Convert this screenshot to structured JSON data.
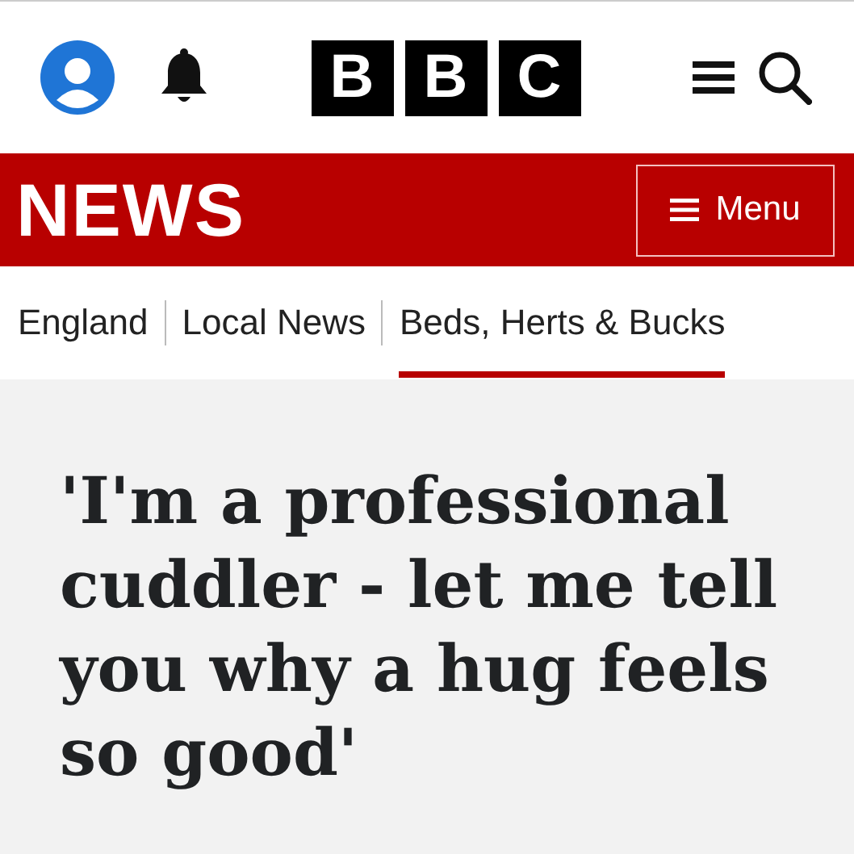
{
  "header": {
    "logo_letters": [
      "B",
      "B",
      "C"
    ]
  },
  "banner": {
    "title": "NEWS",
    "menu_button": "Menu"
  },
  "nav": [
    {
      "label": "England",
      "selected": false
    },
    {
      "label": "Local News",
      "selected": false
    },
    {
      "label": "Beds, Herts & Bucks",
      "selected": true
    }
  ],
  "headline": "'I'm a professional cuddler - let me tell you why a hug feels so good'"
}
